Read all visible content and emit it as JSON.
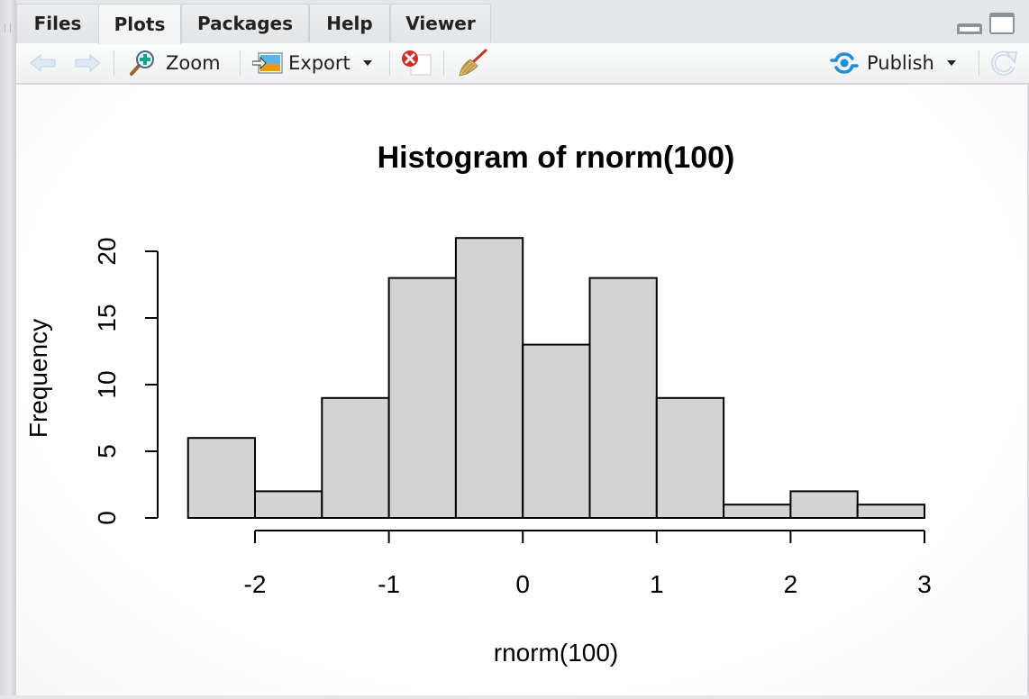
{
  "tabs": [
    {
      "label": "Files",
      "active": false
    },
    {
      "label": "Plots",
      "active": true
    },
    {
      "label": "Packages",
      "active": false
    },
    {
      "label": "Help",
      "active": false
    },
    {
      "label": "Viewer",
      "active": false
    }
  ],
  "window_controls": {
    "minimize_icon": "minimize-pane-icon",
    "maximize_icon": "maximize-pane-icon"
  },
  "toolbar": {
    "back_icon": "arrow-left-icon",
    "forward_icon": "arrow-right-icon",
    "zoom_label": "Zoom",
    "export_label": "Export",
    "remove_icon": "remove-plot-icon",
    "clear_icon": "broom-icon",
    "publish_label": "Publish",
    "refresh_icon": "refresh-icon",
    "colors": {
      "publish_accent": "#1d8fd8",
      "remove_red": "#c9302c"
    }
  },
  "chart_data": {
    "type": "bar",
    "subtype": "histogram",
    "title": "Histogram of rnorm(100)",
    "xlabel": "rnorm(100)",
    "ylabel": "Frequency",
    "bin_edges": [
      -2.5,
      -2.0,
      -1.5,
      -1.0,
      -0.5,
      0.0,
      0.5,
      1.0,
      1.5,
      2.0,
      2.5,
      3.0
    ],
    "values": [
      6,
      2,
      9,
      18,
      21,
      13,
      18,
      9,
      1,
      2,
      1
    ],
    "xticks": [
      -2,
      -1,
      0,
      1,
      2,
      3
    ],
    "xtick_labels": [
      "-2",
      "-1",
      "0",
      "1",
      "2",
      "3"
    ],
    "yticks": [
      0,
      5,
      10,
      15,
      20
    ],
    "ytick_labels": [
      "0",
      "5",
      "10",
      "15",
      "20"
    ],
    "xlim": [
      -2.5,
      3.0
    ],
    "ylim": [
      0,
      21
    ],
    "grid": false,
    "legend": "none",
    "bar_fill": "#d3d3d3",
    "bar_stroke": "#000000"
  }
}
